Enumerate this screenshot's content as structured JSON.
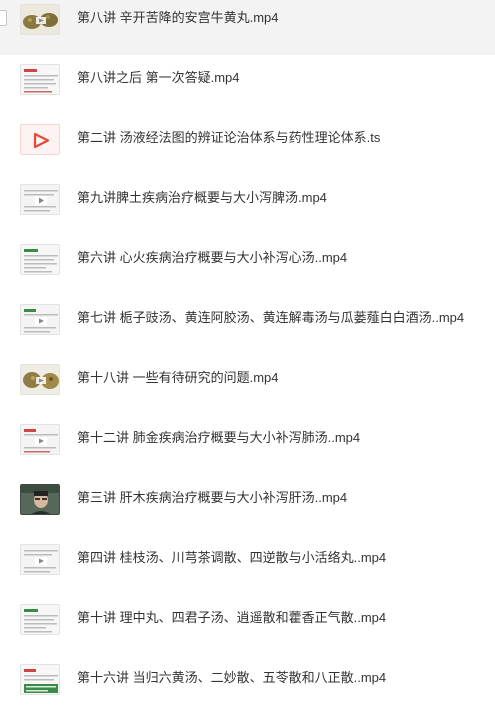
{
  "files": [
    {
      "name": "第八讲 辛开苦降的安宫牛黄丸.mp4",
      "thumb": "herbs-thumbnail",
      "selected": true
    },
    {
      "name": "第八讲之后 第一次答疑.mp4",
      "thumb": "slide-thumbnail",
      "selected": false
    },
    {
      "name": "第二讲 汤液经法图的辨证论治体系与药性理论体系.ts",
      "thumb": "video-file-icon",
      "selected": false
    },
    {
      "name": "第九讲脾土疾病治疗概要与大小泻脾汤.mp4",
      "thumb": "slide-play-thumbnail",
      "selected": false
    },
    {
      "name": "第六讲 心火疾病治疗概要与大小补泻心汤..mp4",
      "thumb": "slide-thumbnail",
      "selected": false
    },
    {
      "name": "第七讲 栀子豉汤、黄连阿胶汤、黄连解毒汤与瓜蒌薤白白酒汤..mp4",
      "thumb": "slide-play-thumbnail",
      "selected": false
    },
    {
      "name": "第十八讲 一些有待研究的问题.mp4",
      "thumb": "herbs-thumbnail",
      "selected": false
    },
    {
      "name": "第十二讲 肺金疾病治疗概要与大小补泻肺汤..mp4",
      "thumb": "slide-play-thumbnail",
      "selected": false
    },
    {
      "name": "第三讲 肝木疾病治疗概要与大小补泻肝汤..mp4",
      "thumb": "speaker-thumbnail",
      "selected": false
    },
    {
      "name": "第四讲 桂枝汤、川芎茶调散、四逆散与小活络丸..mp4",
      "thumb": "slide-play-thumbnail",
      "selected": false
    },
    {
      "name": "第十讲 理中丸、四君子汤、逍遥散和藿香正气散..mp4",
      "thumb": "slide-thumbnail",
      "selected": false
    },
    {
      "name": "第十六讲 当归六黄汤、二妙散、五苓散和八正散..mp4",
      "thumb": "slide-green-thumbnail",
      "selected": false
    }
  ],
  "colors": {
    "selected_row": "#f3f3f3",
    "text": "#333333",
    "play_red": "#e6483d"
  }
}
